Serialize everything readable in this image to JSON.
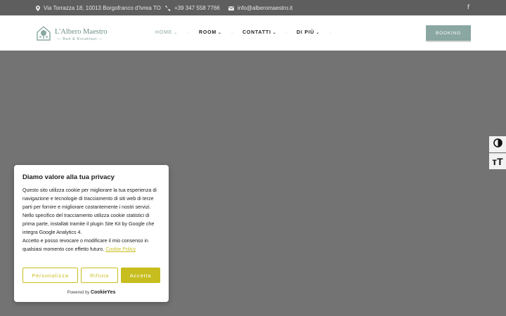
{
  "topbar": {
    "address": "Via Torrazza 18, 10013 Borgofranco d'Ivrea TO",
    "phone": "+39 347 558 7766",
    "email": "info@alberomaestro.it",
    "social_icon": "facebook-icon",
    "social_glyph": "f"
  },
  "logo": {
    "title": "L'Albero Maestro",
    "subtitle": "— Bed & Breakfast —"
  },
  "nav": {
    "home": "HOME",
    "room": "ROOM",
    "contatti": "CONTATTI",
    "di_piu": "DI PIÙ",
    "chevron": "⌄",
    "separator": "·"
  },
  "booking_label": "BOOKING",
  "accessibility": {
    "font_toggle": "ᴛT"
  },
  "cookie": {
    "title": "Diamo valore alla tua privacy",
    "body": "Questo sito utilizza cookie per migliorare la tua esperienza di navigazione e tecnologie di tracciamento di siti web di terze parti per fornire e migliorare costantemente i nostri servizi. Nello specifico del tracciamento utilizza cookie statistici di prima parte, installati tramite il plugin Site Kit by Google che integra Google Analytics 4.",
    "body2": "Accetto e posso revocare o modificare il mio consenso in qualsiasi momento con effetto futuro.",
    "policy_link": "Cookie Policy",
    "customize": "Personalizza",
    "reject": "Rifiuta",
    "accept": "Accetta",
    "powered_by": "Powered by",
    "brand": "CookieYes"
  },
  "colors": {
    "accent": "#8aa7a1",
    "cookie_accent": "#c7bd1e",
    "topbar": "#5e5e5e",
    "hero": "#737373"
  }
}
